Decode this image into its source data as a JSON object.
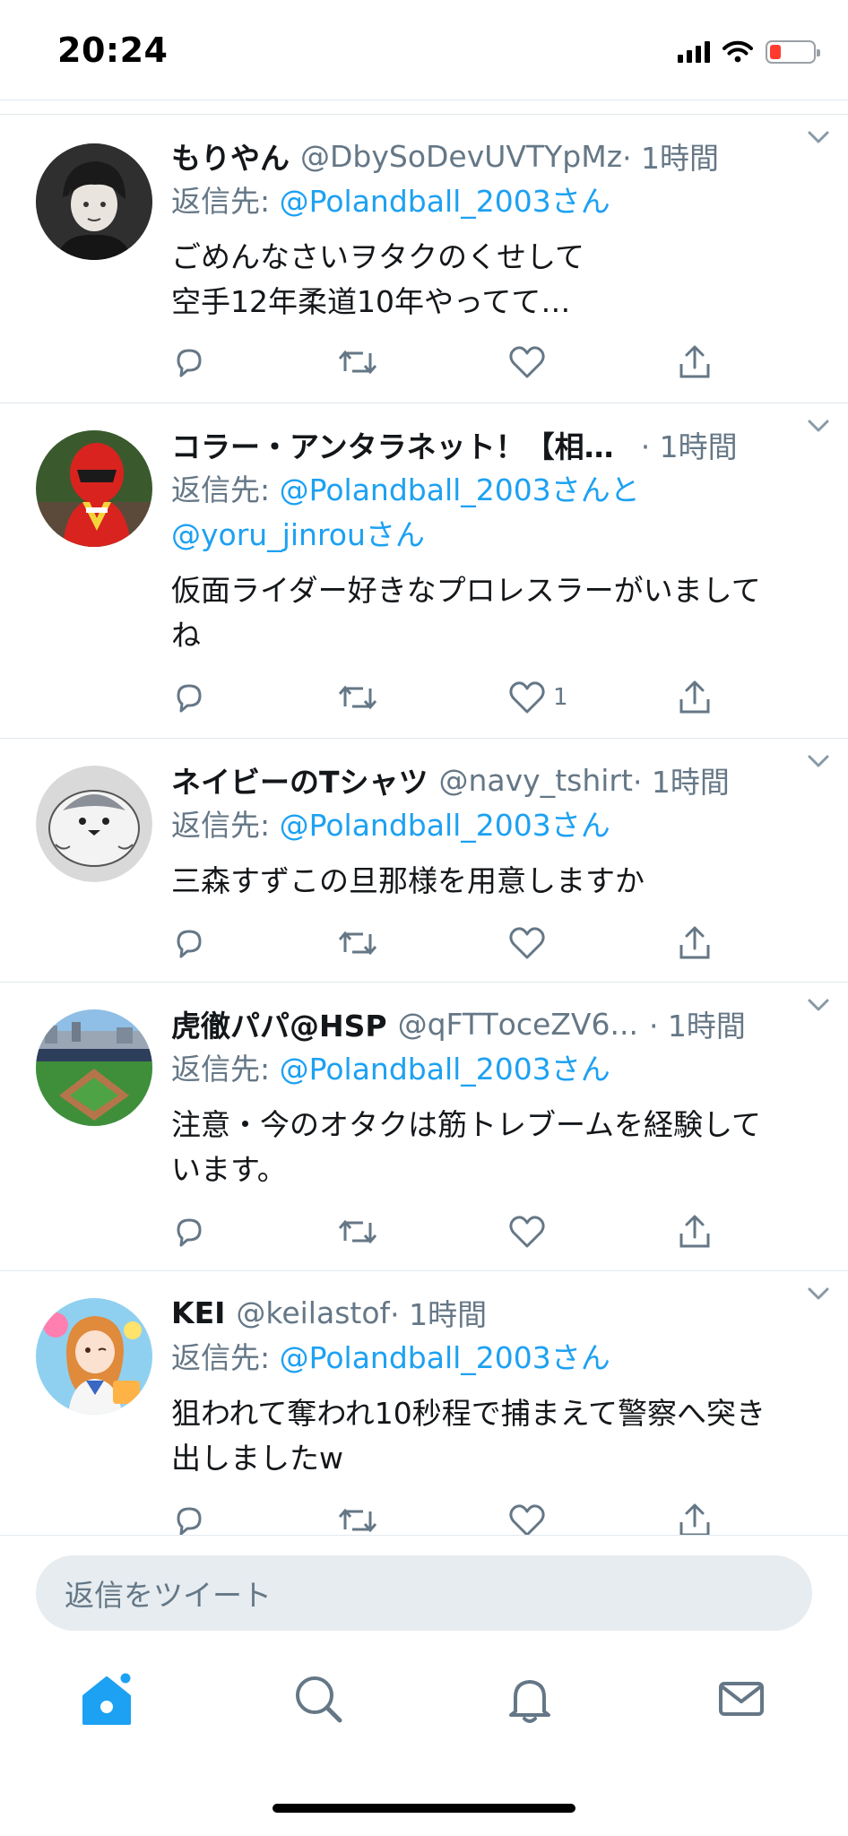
{
  "status_bar": {
    "time": "20:24"
  },
  "tweets": [
    {
      "name": "もりやん",
      "handle": "@DbySoDevUVTYpMz",
      "time": "· 1時間",
      "reply_prefix": "返信先: ",
      "reply_mentions": "@Polandball_2003さん",
      "text_lines": [
        "ごめんなさいヲタクのくせして",
        "空手12年柔道10年やってて…"
      ],
      "likes": ""
    },
    {
      "name": "コラー・アンタラネット！【相…",
      "handle": "",
      "time": "· 1時間",
      "reply_prefix": "返信先: ",
      "reply_mentions": "@Polandball_2003さんと",
      "reply_mentions_2": "@yoru_jinrouさん",
      "text_lines": [
        "仮面ライダー好きなプロレスラーがいまして",
        "ね"
      ],
      "likes": "1"
    },
    {
      "name": "ネイビーのTシャツ",
      "handle": "@navy_tshirt",
      "time": "· 1時間",
      "reply_prefix": "返信先: ",
      "reply_mentions": "@Polandball_2003さん",
      "text_lines": [
        "三森すずこの旦那様を用意しますか"
      ],
      "likes": ""
    },
    {
      "name": "虎徹パパ@HSP",
      "handle": "@qFTTοceZV6...",
      "time": "· 1時間",
      "reply_prefix": "返信先: ",
      "reply_mentions": "@Polandball_2003さん",
      "text_lines": [
        "注意・今のオタクは筋トレブームを経験して",
        "います。"
      ],
      "likes": ""
    },
    {
      "name": "KEI",
      "handle": "@keilastof",
      "time": "· 1時間",
      "reply_prefix": "返信先: ",
      "reply_mentions": "@Polandball_2003さん",
      "text_lines": [
        "狙われて奪われ10秒程で捕まえて警察へ突き",
        "出しましたw"
      ],
      "likes": ""
    }
  ],
  "reply_bar": {
    "placeholder": "返信をツイート"
  },
  "colors": {
    "accent": "#1da1f2",
    "secondary_text": "#657786",
    "divider": "#e1e8ed",
    "input_bg": "#e6ecf0"
  },
  "icons": {
    "actions": [
      "reply-icon",
      "retweet-icon",
      "like-icon",
      "share-icon"
    ],
    "tabs": [
      "home-icon",
      "search-icon",
      "notifications-icon",
      "messages-icon"
    ]
  }
}
